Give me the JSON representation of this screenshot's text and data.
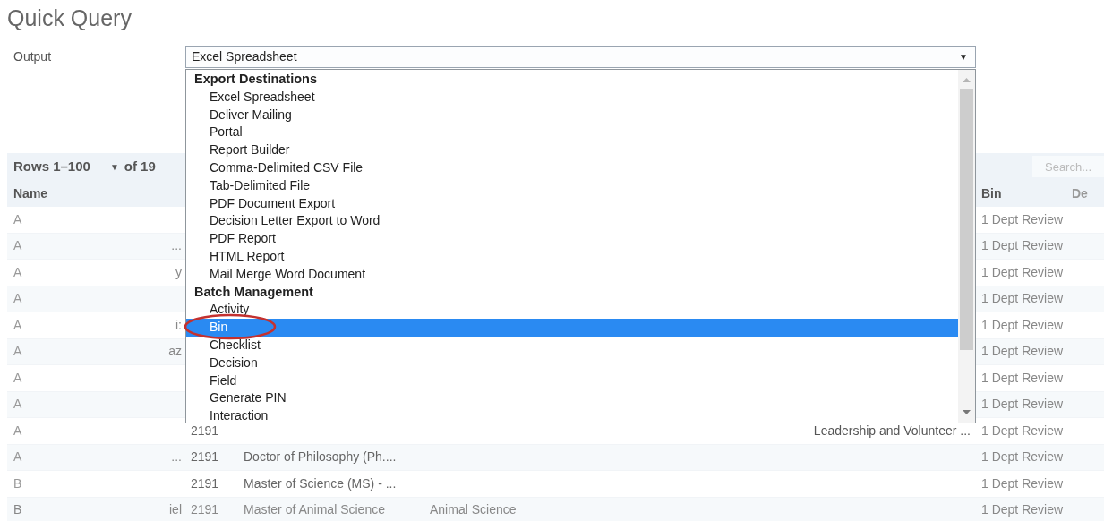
{
  "page": {
    "title": "Quick Query"
  },
  "output": {
    "label": "Output",
    "value": "Excel Spreadsheet",
    "caret": "▼",
    "expanded": true,
    "groups": [
      {
        "label": "Export Destinations",
        "items": [
          {
            "label": "Excel Spreadsheet",
            "selected": false
          },
          {
            "label": "Deliver Mailing",
            "selected": false
          },
          {
            "label": "Portal",
            "selected": false
          },
          {
            "label": "Report Builder",
            "selected": false
          },
          {
            "label": "Comma-Delimited CSV File",
            "selected": false
          },
          {
            "label": "Tab-Delimited File",
            "selected": false
          },
          {
            "label": "PDF Document Export",
            "selected": false
          },
          {
            "label": "Decision Letter Export to Word",
            "selected": false
          },
          {
            "label": "PDF Report",
            "selected": false
          },
          {
            "label": "HTML Report",
            "selected": false
          },
          {
            "label": "Mail Merge Word Document",
            "selected": false
          }
        ]
      },
      {
        "label": "Batch Management",
        "items": [
          {
            "label": "Activity",
            "selected": false
          },
          {
            "label": "Bin",
            "selected": true
          },
          {
            "label": "Checklist",
            "selected": false
          },
          {
            "label": "Decision",
            "selected": false
          },
          {
            "label": "Field",
            "selected": false
          },
          {
            "label": "Generate PIN",
            "selected": false
          },
          {
            "label": "Interaction",
            "selected": false
          }
        ]
      }
    ]
  },
  "annotation": {
    "kind": "ellipse"
  },
  "table": {
    "pager": {
      "rows": "Rows 1–100",
      "caret": "▼",
      "total": "of 19"
    },
    "search": {
      "placeholder": "Search..."
    },
    "columns": [
      "Name",
      "Bin",
      "De"
    ],
    "rows": [
      {
        "name": "A",
        "bin": "1 Dept Review"
      },
      {
        "name": "A",
        "column_2": "...",
        "bin": "1 Dept Review"
      },
      {
        "name": "A",
        "column_2": "y",
        "bin": "1 Dept Review"
      },
      {
        "name": "A",
        "bin": "1 Dept Review"
      },
      {
        "name": "A",
        "column_2": "i:",
        "bin": "1 Dept Review"
      },
      {
        "name": "A",
        "column_2": "az",
        "bin": "1 Dept Review"
      },
      {
        "name": "A",
        "bin": "1 Dept Review"
      },
      {
        "name": "A",
        "bin": "1 Dept Review"
      },
      {
        "name": "A",
        "column_3": "2191",
        "column_6": "Leadership and Volunteer ...",
        "bin": "1 Dept Review"
      },
      {
        "name": "A",
        "column_2": "...",
        "column_3": "2191",
        "column_4": "Doctor of Philosophy (Ph....",
        "bin": "1 Dept Review"
      },
      {
        "name": "B",
        "column_3": "2191",
        "column_4": "Master of Science (MS) - ...",
        "bin": "1 Dept Review"
      },
      {
        "name": "B",
        "column_2": "iel",
        "column_3": "2191",
        "column_4": "Master of Animal Science",
        "column_5": "Animal Science",
        "bin": "1 Dept Review"
      }
    ]
  }
}
